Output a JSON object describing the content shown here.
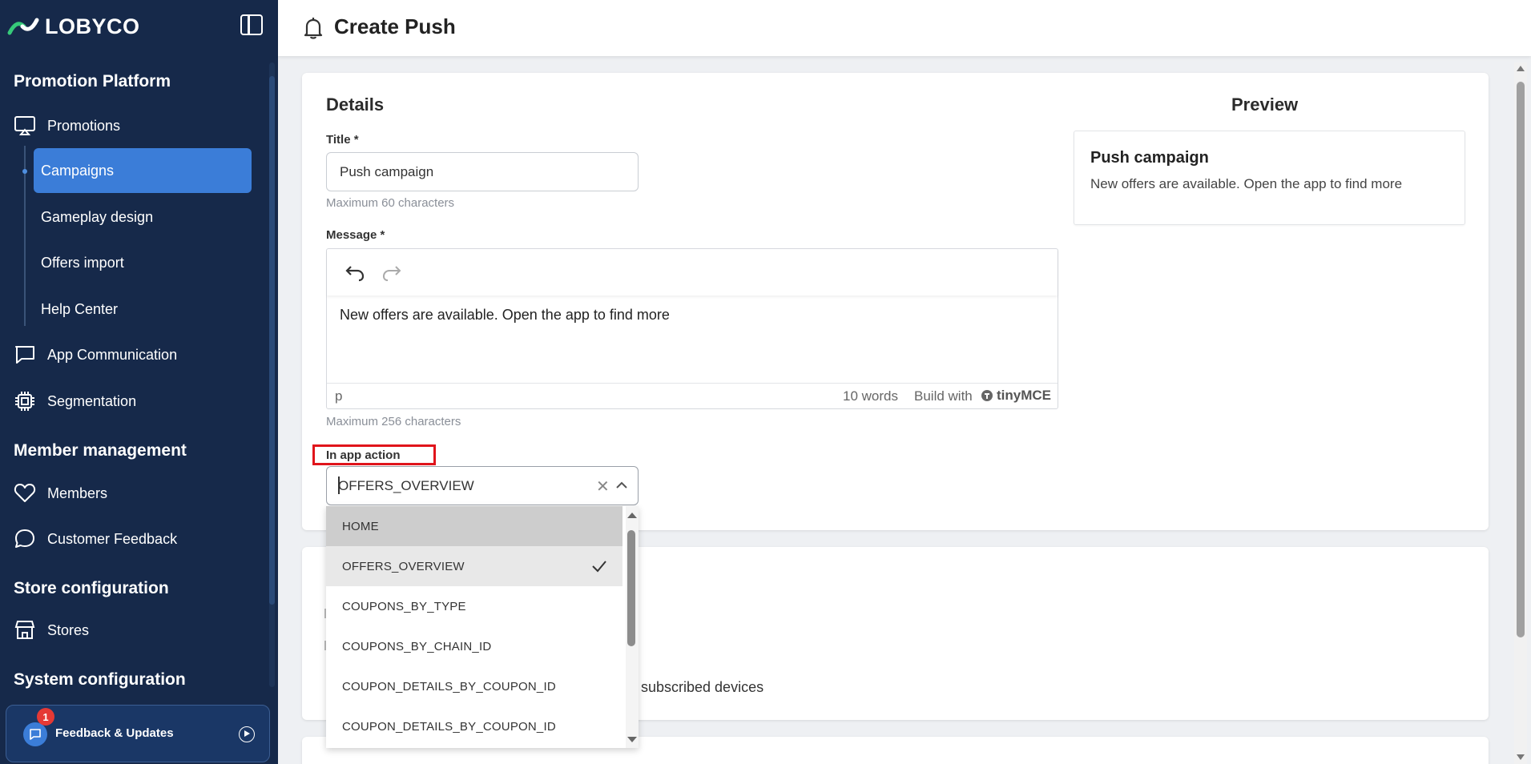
{
  "sidebar": {
    "brand": "LOBYCO",
    "sections": {
      "promotion": "Promotion Platform",
      "member": "Member management",
      "store": "Store configuration",
      "system": "System configuration"
    },
    "items": {
      "promotions": "Promotions",
      "campaigns": "Campaigns",
      "gameplay": "Gameplay design",
      "offers_import": "Offers import",
      "help_center": "Help Center",
      "app_communication": "App Communication",
      "segmentation": "Segmentation",
      "members": "Members",
      "customer_feedback": "Customer Feedback",
      "stores": "Stores"
    },
    "feedback": {
      "label": "Feedback & Updates",
      "badge": "1"
    }
  },
  "header": {
    "title": "Create Push"
  },
  "details": {
    "title": "Details",
    "title_label": "Title *",
    "title_value": "Push campaign",
    "title_hint": "Maximum 60 characters",
    "message_label": "Message *",
    "message_value": "New offers are available. Open the app to find more",
    "editor_tag": "p",
    "word_count": "10 words",
    "build_with": "Build with",
    "editor_brand": "tinyMCE",
    "message_hint": "Maximum 256 characters",
    "action_label": "In app action",
    "action_value": "OFFERS_OVERVIEW",
    "options": [
      "HOME",
      "OFFERS_OVERVIEW",
      "COUPONS_BY_TYPE",
      "COUPONS_BY_CHAIN_ID",
      "COUPON_DETAILS_BY_COUPON_ID",
      "COUPON_DETAILS_BY_COUPON_ID"
    ]
  },
  "behind": {
    "subscribed_text": "subscribed devices"
  },
  "preview": {
    "title": "Preview",
    "push_title": "Push campaign",
    "push_message": "New offers are available. Open the app to find more"
  },
  "colors": {
    "sidebar_bg": "#16294a",
    "active": "#3b7dd8",
    "highlight": "#e0141b"
  }
}
